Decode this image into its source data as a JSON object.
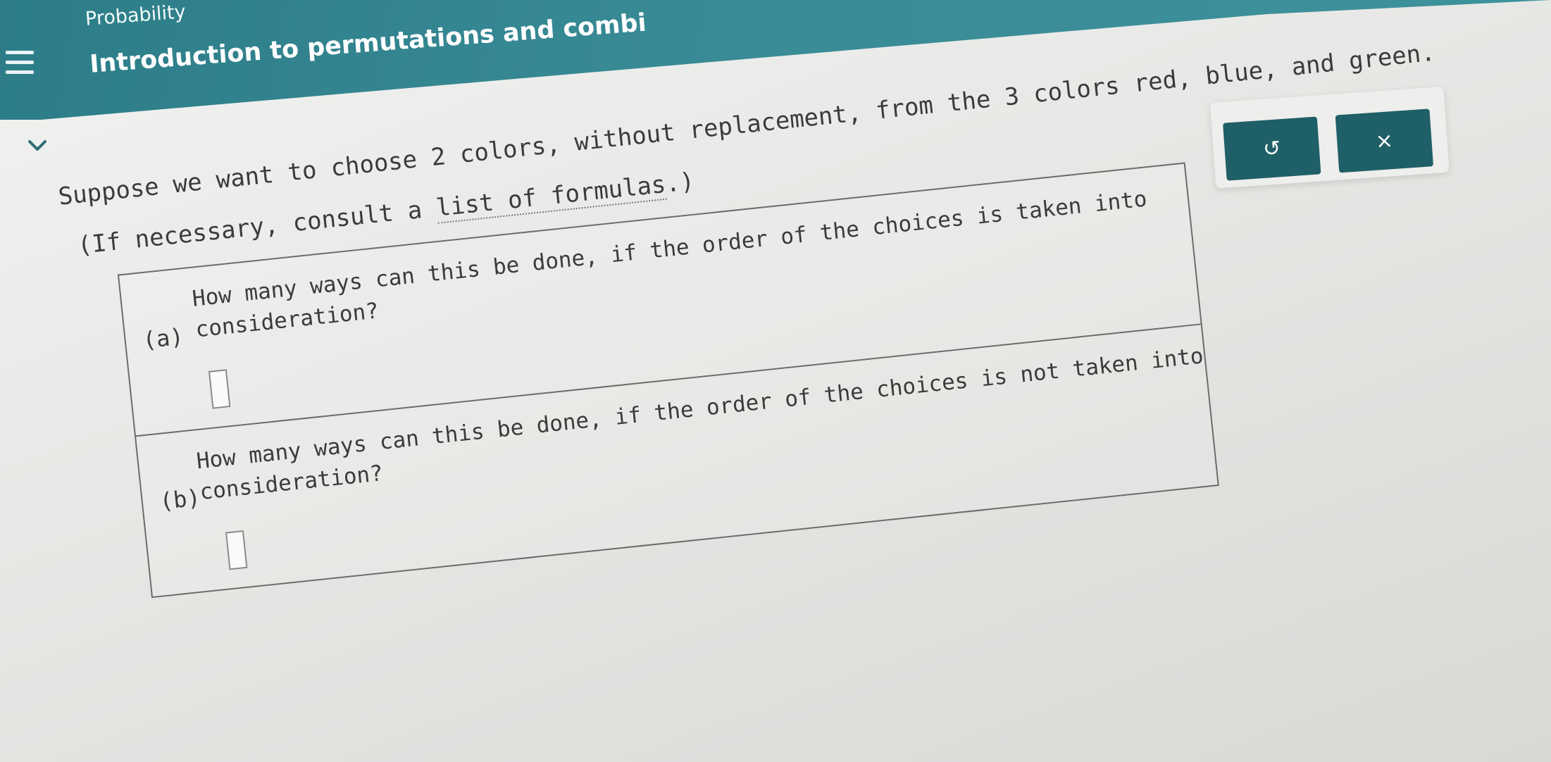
{
  "header": {
    "breadcrumb": "Probability",
    "title": "Introduction to permutations and combi"
  },
  "problem": {
    "statement": "Suppose we want to choose 2 colors, without replacement, from the 3 colors red, blue, and green.",
    "formulas_prefix": "(If necessary, consult a ",
    "formulas_link": "list of formulas",
    "formulas_suffix": ".)"
  },
  "parts": [
    {
      "label": "(a)",
      "line1": "How many ways can this be done, if the order of the choices is taken into",
      "line2": "consideration?",
      "answer": ""
    },
    {
      "label": "(b)",
      "line1": "How many ways can this be done, if the order of the choices is not taken into",
      "line2": "consideration?",
      "answer": ""
    }
  ],
  "tools": {
    "undo_icon": "undo-icon",
    "undo_glyph": "↺",
    "clear_icon": "close-icon",
    "clear_glyph": "×"
  },
  "colors": {
    "header": "#3a8c97",
    "tool_button": "#1f5f67"
  }
}
